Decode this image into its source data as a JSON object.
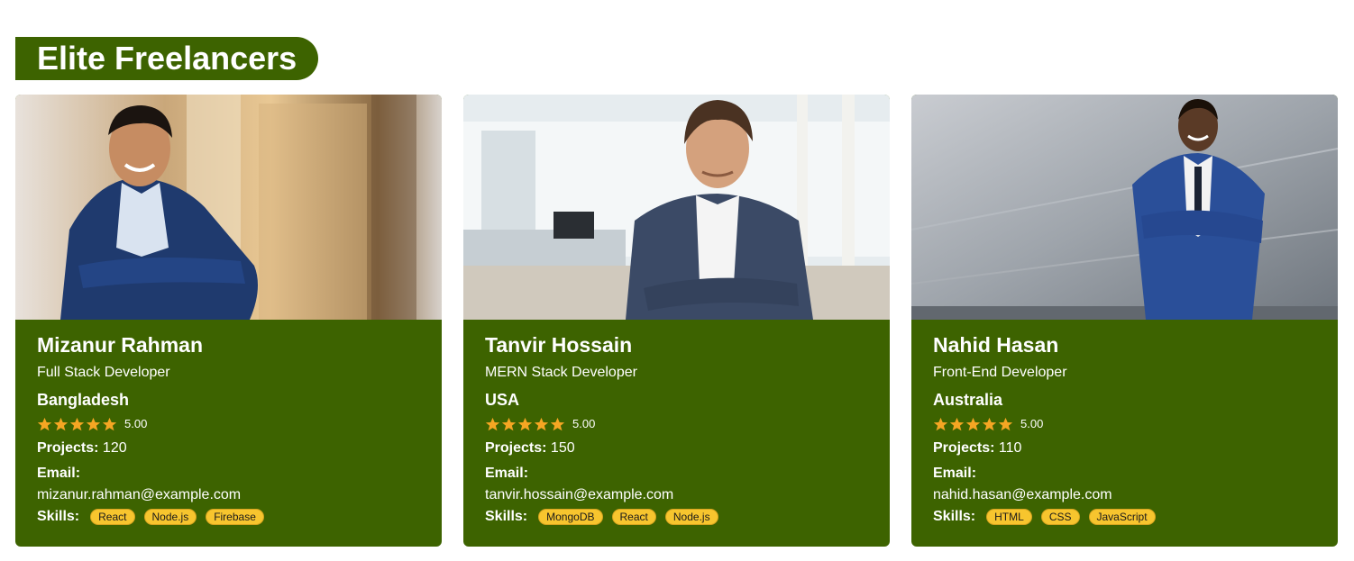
{
  "section": {
    "title": "Elite Freelancers"
  },
  "colors": {
    "card_bg": "#3d6300",
    "skill_pill": "#f7c52e",
    "star": "#f5a623"
  },
  "labels": {
    "projects": "Projects:",
    "email": "Email:",
    "skills": "Skills:"
  },
  "freelancers": [
    {
      "name": "Mizanur Rahman",
      "role": "Full Stack Developer",
      "country": "Bangladesh",
      "rating": "5.00",
      "stars": 5,
      "projects": "120",
      "email": "mizanur.rahman@example.com",
      "skills": [
        "React",
        "Node.js",
        "Firebase"
      ],
      "photo_icon": "portrait-photo"
    },
    {
      "name": "Tanvir Hossain",
      "role": "MERN Stack Developer",
      "country": "USA",
      "rating": "5.00",
      "stars": 5,
      "projects": "150",
      "email": "tanvir.hossain@example.com",
      "skills": [
        "MongoDB",
        "React",
        "Node.js"
      ],
      "photo_icon": "portrait-photo"
    },
    {
      "name": "Nahid Hasan",
      "role": "Front-End Developer",
      "country": "Australia",
      "rating": "5.00",
      "stars": 5,
      "projects": "110",
      "email": "nahid.hasan@example.com",
      "skills": [
        "HTML",
        "CSS",
        "JavaScript"
      ],
      "photo_icon": "portrait-photo"
    }
  ]
}
